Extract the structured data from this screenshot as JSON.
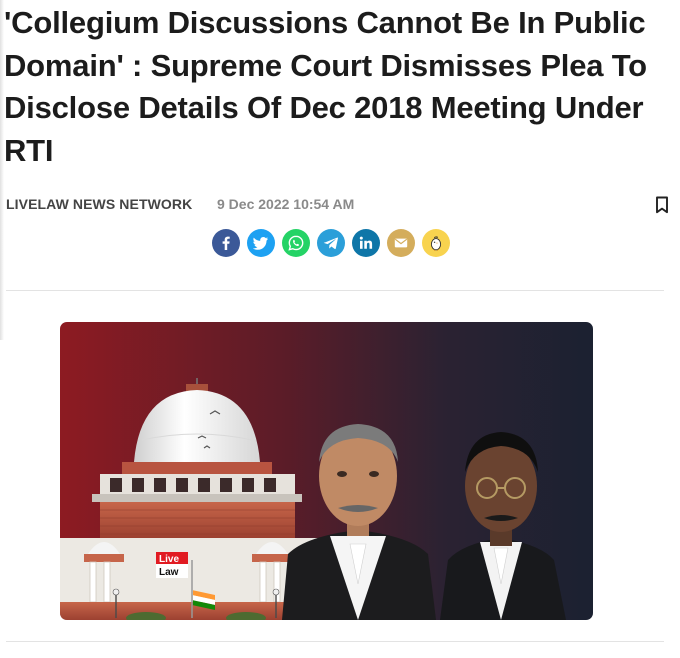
{
  "article": {
    "headline": "'Collegium Discussions Cannot Be In Public Domain' : Supreme Court Dismisses Plea To Disclose Details Of Dec 2018 Meeting Under RTI",
    "author": "LIVELAW NEWS NETWORK",
    "date": "9 Dec 2022 10:54 AM"
  },
  "actions": {
    "bookmark_icon": "bookmark-icon"
  },
  "share": [
    {
      "name": "facebook",
      "icon": "facebook-icon",
      "color": "#3b5998"
    },
    {
      "name": "twitter",
      "icon": "twitter-icon",
      "color": "#1da1f2"
    },
    {
      "name": "whatsapp",
      "icon": "whatsapp-icon",
      "color": "#25d366"
    },
    {
      "name": "telegram",
      "icon": "telegram-icon",
      "color": "#2b9fd9"
    },
    {
      "name": "linkedin",
      "icon": "linkedin-icon",
      "color": "#0e76a8"
    },
    {
      "name": "email",
      "icon": "email-icon",
      "color": "#d4ad5c"
    },
    {
      "name": "koo",
      "icon": "koo-icon",
      "color": "#f8d34f"
    }
  ],
  "hero_image": {
    "logo_line1": "Live",
    "logo_line2": "Law",
    "colors": {
      "left": "#8d1b22",
      "right": "#1b2131"
    }
  }
}
